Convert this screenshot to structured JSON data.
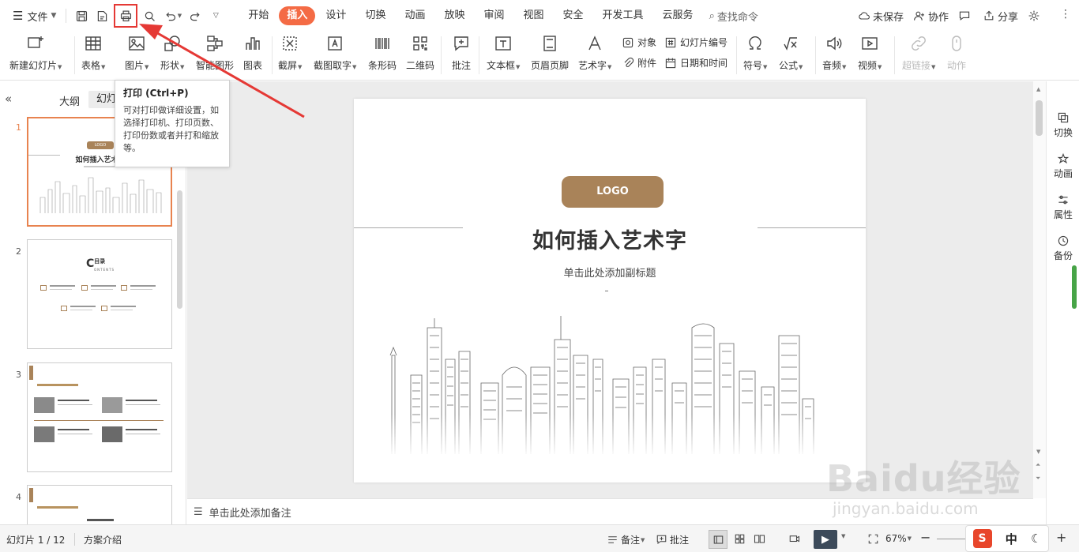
{
  "menu": {
    "file_label": "文件"
  },
  "tabs": [
    {
      "label": "开始",
      "active": false
    },
    {
      "label": "插入",
      "active": true
    },
    {
      "label": "设计",
      "active": false
    },
    {
      "label": "切换",
      "active": false
    },
    {
      "label": "动画",
      "active": false
    },
    {
      "label": "放映",
      "active": false
    },
    {
      "label": "审阅",
      "active": false
    },
    {
      "label": "视图",
      "active": false
    },
    {
      "label": "安全",
      "active": false
    },
    {
      "label": "开发工具",
      "active": false
    },
    {
      "label": "云服务",
      "active": false
    }
  ],
  "search": {
    "label": "查找命令"
  },
  "topright": {
    "unsaved": "未保存",
    "collab": "协作",
    "share": "分享"
  },
  "ribbon": {
    "new_slide": "新建幻灯片",
    "table": "表格",
    "picture": "图片",
    "shape": "形状",
    "smartart": "智能图形",
    "chart": "图表",
    "screenshot": "截屏",
    "ocr": "截图取字",
    "barcode": "条形码",
    "qrcode": "二维码",
    "comment": "批注",
    "textbox": "文本框",
    "header_footer": "页眉页脚",
    "wordart": "艺术字",
    "object": "对象",
    "attachment": "附件",
    "slide_number": "幻灯片编号",
    "datetime": "日期和时间",
    "symbol": "符号",
    "formula": "公式",
    "audio": "音频",
    "video": "视频",
    "hyperlink": "超链接",
    "action": "动作"
  },
  "tooltip": {
    "title": "打印 (Ctrl+P)",
    "body": "可对打印做详细设置，如选择打印机、打印页数、打印份数或者并打和缩放等。"
  },
  "leftpanel": {
    "outline_tab": "大纲",
    "slides_tab": "幻灯",
    "collapse": "«"
  },
  "thumbnails": [
    {
      "num": "1",
      "logo": "LOGO",
      "title": "如何插入艺术字"
    },
    {
      "num": "2",
      "title_letter": "C",
      "title_text": "目录",
      "sub": "ONTENTS"
    },
    {
      "num": "3"
    },
    {
      "num": "4"
    }
  ],
  "slide": {
    "logo": "LOGO",
    "title": "如何插入艺术字",
    "subtitle": "单击此处添加副标题"
  },
  "notes": {
    "placeholder": "单击此处添加备注"
  },
  "rightbar": {
    "transition": "切换",
    "animation": "动画",
    "properties": "属性",
    "backup": "备份"
  },
  "status": {
    "slide_count": "幻灯片 1 / 12",
    "theme": "方案介绍",
    "notes_btn": "备注",
    "comment_btn": "批注",
    "zoom": "67%",
    "ime": "中"
  },
  "watermark": {
    "brand": "Baidu经验",
    "url": "jingyan.baidu.com"
  },
  "colors": {
    "accent": "#f46b45",
    "highlight_red": "#e53935",
    "logo_brown": "#a98359"
  }
}
